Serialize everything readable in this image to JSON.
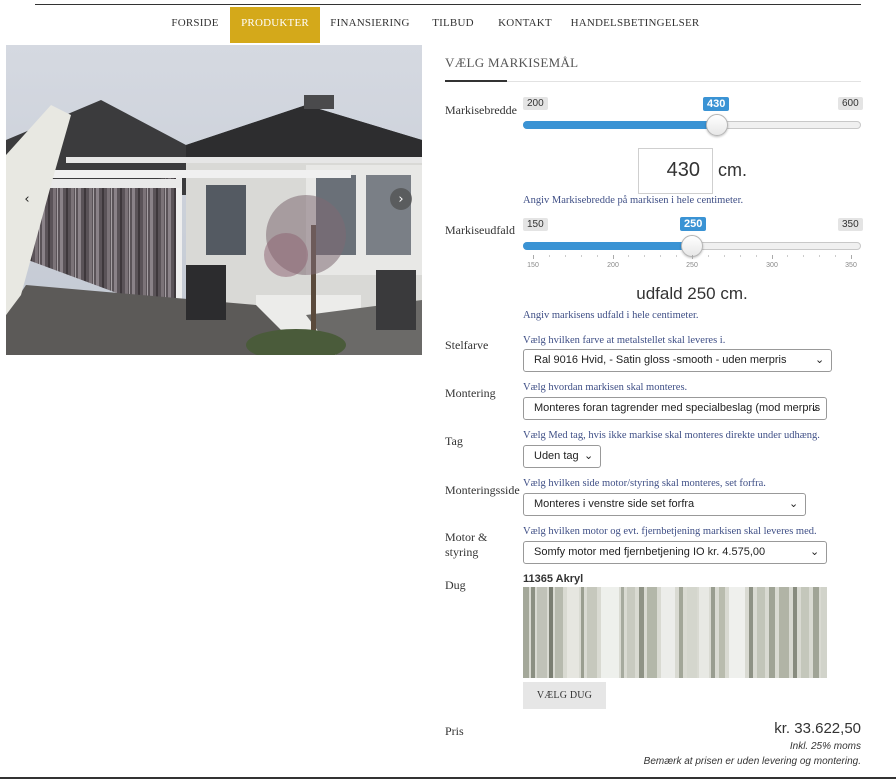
{
  "nav": {
    "items": [
      {
        "label": "FORSIDE",
        "active": false
      },
      {
        "label": "PRODUKTER",
        "active": true
      },
      {
        "label": "FINANSIERING",
        "active": false
      },
      {
        "label": "TILBUD",
        "active": false
      },
      {
        "label": "KONTAKT",
        "active": false
      },
      {
        "label": "HANDELSBETINGELSER",
        "active": false
      }
    ],
    "active_color": "#d4a91a"
  },
  "gallery": {
    "prev_icon": "chevron-left-icon",
    "next_icon": "chevron-right-icon",
    "prev_glyph": "‹",
    "next_glyph": "›"
  },
  "form": {
    "heading": "VÆLG MARKISEMÅL",
    "bredde": {
      "label": "Markisebredde",
      "min": "200",
      "max": "600",
      "value": "430",
      "fraction": 0.575,
      "input_value": "430",
      "unit": "cm.",
      "help": "Angiv Markisebredde på markisen i hele centimeter."
    },
    "udfald": {
      "label": "Markiseudfald",
      "min": "150",
      "max": "350",
      "value": "250",
      "fraction": 0.5,
      "ticks": [
        "150",
        "200",
        "250",
        "300",
        "350"
      ],
      "display": "udfald 250 cm.",
      "help": "Angiv markisens udfald i hele centimeter."
    },
    "stelfarve": {
      "label": "Stelfarve",
      "help": "Vælg hvilken farve at metalstellet skal leveres i.",
      "selected": "Ral 9016 Hvid, - Satin gloss -smooth - uden merpris"
    },
    "montering": {
      "label": "Montering",
      "help": "Vælg hvordan markisen skal monteres.",
      "selected": "Monteres foran tagrender med specialbeslag (mod merpris"
    },
    "tag": {
      "label": "Tag",
      "help": "Vælg Med tag, hvis ikke markise skal monteres direkte under udhæng.",
      "selected": "Uden tag"
    },
    "monteringsside": {
      "label": "Monteringsside",
      "help": "Vælg hvilken side motor/styring skal monteres, set forfra.",
      "selected": "Monteres i venstre side set forfra"
    },
    "motor": {
      "label_line1": "Motor &",
      "label_line2": "styring",
      "help": "Vælg hvilken motor og evt. fjernbetjening markisen skal leveres med.",
      "selected": "Somfy motor med fjernbetjening IO kr. 4.575,00"
    },
    "dug": {
      "label": "Dug",
      "title": "11365 Akryl",
      "button": "VÆLG DUG"
    },
    "pris": {
      "label": "Pris",
      "value": "kr. 33.622,50",
      "moms": "Inkl. 25% moms",
      "note": "Bemærk at prisen er uden levering og montering."
    }
  },
  "colors": {
    "slider_fill": "#3a93d4",
    "help_text": "#3f4f86"
  }
}
